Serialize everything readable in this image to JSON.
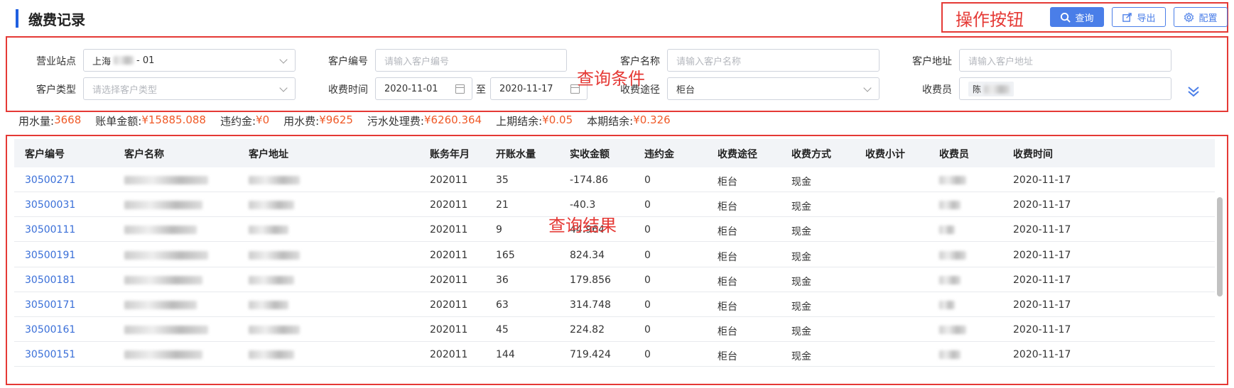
{
  "page": {
    "title": "缴费记录"
  },
  "toolbar": {
    "annotation": "操作按钮",
    "query_label": "查询",
    "export_label": "导出",
    "config_label": "配置"
  },
  "filters": {
    "annotation": "查询条件",
    "station": {
      "label": "营业站点",
      "value_prefix": "上海",
      "value_suffix": "- 01"
    },
    "customer_no": {
      "label": "客户编号",
      "placeholder": "请输入客户编号"
    },
    "customer_name": {
      "label": "客户名称",
      "placeholder": "请输入客户名称"
    },
    "customer_addr": {
      "label": "客户地址",
      "placeholder": "请输入客户地址"
    },
    "customer_type": {
      "label": "客户类型",
      "placeholder": "请选择客户类型"
    },
    "charge_time": {
      "label": "收费时间",
      "start": "2020-11-01",
      "separator": "至",
      "end": "2020-11-17"
    },
    "channel": {
      "label": "收费途径",
      "value": "柜台"
    },
    "collector": {
      "label": "收费员",
      "value_prefix": "陈"
    }
  },
  "summary": [
    {
      "label": "用水量:",
      "value": "3668"
    },
    {
      "label": "账单金额:",
      "value": "¥15885.088"
    },
    {
      "label": "违约金:",
      "value": "¥0"
    },
    {
      "label": "用水费:",
      "value": "¥9625"
    },
    {
      "label": "污水处理费:",
      "value": "¥6260.364"
    },
    {
      "label": "上期结余:",
      "value": "¥0.05"
    },
    {
      "label": "本期结余:",
      "value": "¥0.326"
    }
  ],
  "table": {
    "annotation": "查询结果",
    "columns": [
      "客户编号",
      "客户名称",
      "客户地址",
      "账务年月",
      "开账水量",
      "实收金额",
      "违约金",
      "收费途径",
      "收费方式",
      "收费小计",
      "收费员",
      "收费时间"
    ],
    "rows": [
      {
        "no": "30500271",
        "period": "202011",
        "volume": "35",
        "amount": "-174.86",
        "penalty": "0",
        "channel": "柜台",
        "method": "现金",
        "subtotal": "",
        "time": "2020-11-17"
      },
      {
        "no": "30500031",
        "period": "202011",
        "volume": "21",
        "amount": "-40.3",
        "penalty": "0",
        "channel": "柜台",
        "method": "现金",
        "subtotal": "",
        "time": "2020-11-17"
      },
      {
        "no": "30500111",
        "period": "202011",
        "volume": "9",
        "amount": "44.964",
        "penalty": "0",
        "channel": "柜台",
        "method": "现金",
        "subtotal": "",
        "time": "2020-11-17"
      },
      {
        "no": "30500191",
        "period": "202011",
        "volume": "165",
        "amount": "824.34",
        "penalty": "0",
        "channel": "柜台",
        "method": "现金",
        "subtotal": "",
        "time": "2020-11-17"
      },
      {
        "no": "30500181",
        "period": "202011",
        "volume": "36",
        "amount": "179.856",
        "penalty": "0",
        "channel": "柜台",
        "method": "现金",
        "subtotal": "",
        "time": "2020-11-17"
      },
      {
        "no": "30500171",
        "period": "202011",
        "volume": "63",
        "amount": "314.748",
        "penalty": "0",
        "channel": "柜台",
        "method": "现金",
        "subtotal": "",
        "time": "2020-11-17"
      },
      {
        "no": "30500161",
        "period": "202011",
        "volume": "45",
        "amount": "224.82",
        "penalty": "0",
        "channel": "柜台",
        "method": "现金",
        "subtotal": "",
        "time": "2020-11-17"
      },
      {
        "no": "30500151",
        "period": "202011",
        "volume": "144",
        "amount": "719.424",
        "penalty": "0",
        "channel": "柜台",
        "method": "现金",
        "subtotal": "",
        "time": "2020-11-17"
      }
    ]
  },
  "colors": {
    "primary": "#4a7ee8",
    "highlight": "#f05a28",
    "annotation": "#e53935",
    "link": "#3a6fd8"
  },
  "icons": {
    "query": "search-icon",
    "export": "export-icon",
    "config": "gear-icon",
    "expand": "double-chevron-down-icon"
  }
}
